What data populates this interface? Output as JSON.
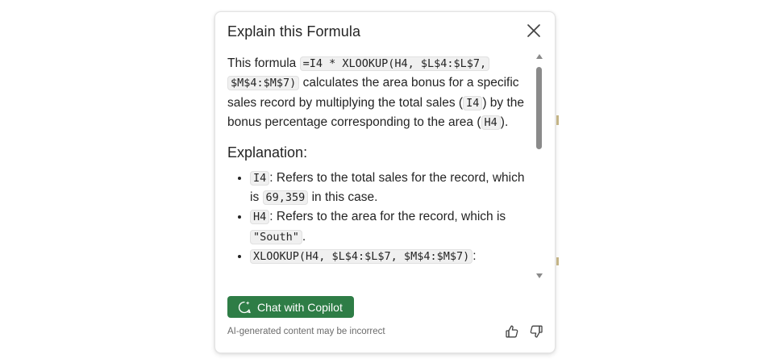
{
  "panel": {
    "title": "Explain this Formula",
    "intro": {
      "t1": "This formula ",
      "formula_part1": "=I4 * XLOOKUP(H4, $L$4:$L$7,",
      "formula_part2": "$M$4:$M$7)",
      "t2": " calculates the area bonus for a specific sales record by multiplying the total sales (",
      "cell_sales": "I4",
      "t3": ") by the bonus percentage corresponding to the area (",
      "cell_area": "H4",
      "t4": ")."
    },
    "explanation_heading": "Explanation:",
    "points": [
      {
        "code": "I4",
        "text": ": Refers to the total sales for the record, which is ",
        "value": "69,359",
        "tail": " in this case."
      },
      {
        "code": "H4",
        "text": ": Refers to the area for the record, which is ",
        "value": "\"South\"",
        "tail": "."
      },
      {
        "code": "XLOOKUP(H4, $L$4:$L$7, $M$4:$M$7)",
        "text": ":"
      }
    ],
    "chat_button_label": "Chat with Copilot",
    "disclaimer": "AI-generated content may be incorrect"
  },
  "colors": {
    "primary_button": "#2e7d46",
    "code_background": "#f0f0f0",
    "text": "#242424",
    "muted_text": "#6b6b6b"
  },
  "icons": {
    "close": "close-icon",
    "chat": "chat-sparkle-icon",
    "like": "thumbs-up-icon",
    "dislike": "thumbs-down-icon"
  }
}
